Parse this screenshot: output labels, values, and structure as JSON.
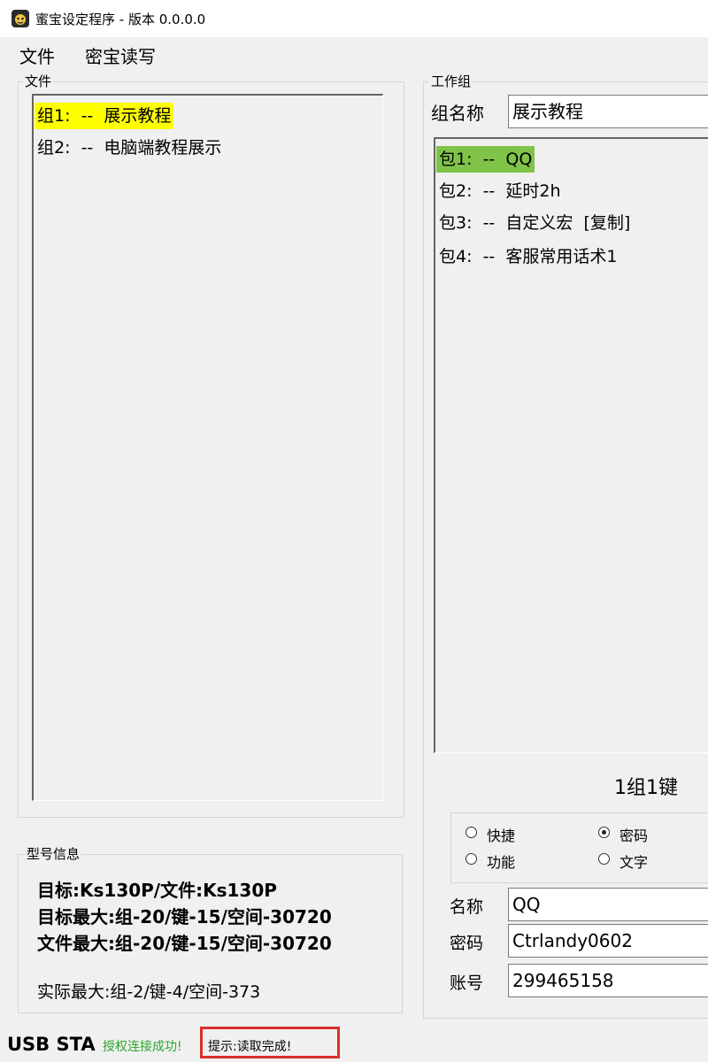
{
  "window": {
    "title": "蜜宝设定程序 - 版本 0.0.0.0"
  },
  "menu": {
    "file": "文件",
    "read_write": "密宝读写"
  },
  "file_panel": {
    "label": "文件",
    "groups": [
      {
        "label": "组1:  --  展示教程"
      },
      {
        "label": "组2:  --  电脑端教程展示"
      }
    ]
  },
  "work_panel": {
    "label": "工作组",
    "group_name_label": "组名称",
    "group_name_value": "展示教程",
    "packages": [
      {
        "label": "包1:  --  QQ"
      },
      {
        "label": "包2:  --  延时2h"
      },
      {
        "label": "包3:  --  自定义宏  [复制]"
      },
      {
        "label": "包4:  --  客服常用话术1"
      }
    ],
    "key_count": "1组1键",
    "types": {
      "shortcut": "快捷",
      "password": "密码",
      "function": "功能",
      "text": "文字"
    },
    "selected_type": "password",
    "fields": {
      "name_label": "名称",
      "name_value": "QQ",
      "password_label": "密码",
      "password_value": "Ctrlandy0602",
      "account_label": "账号",
      "account_value": "299465158"
    }
  },
  "model_info": {
    "label": "型号信息",
    "target": "目标:Ks130P/文件:Ks130P",
    "target_max": "目标最大:组-20/键-15/空间-30720",
    "file_max": "文件最大:组-20/键-15/空间-30720",
    "actual_max": "实际最大:组-2/键-4/空间-373"
  },
  "status": {
    "usb": "USB STA",
    "auth": "授权连接成功!",
    "hint": "提示:读取完成!",
    "auth_color": "#2ea52e",
    "hint_border_color": "#d9302c"
  }
}
